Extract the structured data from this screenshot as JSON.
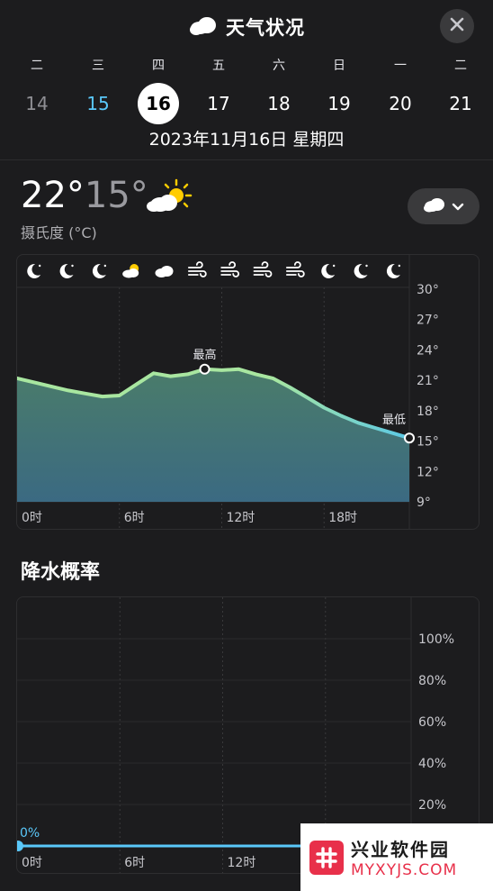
{
  "header": {
    "title": "天气状况",
    "title_icon": "cloud-icon",
    "close_icon": "close-icon"
  },
  "week": {
    "weekdays": [
      "二",
      "三",
      "四",
      "五",
      "六",
      "日",
      "一",
      "二"
    ],
    "dates": [
      "14",
      "15",
      "16",
      "17",
      "18",
      "19",
      "20",
      "21"
    ],
    "today_index": 1,
    "selected_index": 2,
    "full_date": "2023年11月16日 星期四"
  },
  "summary": {
    "high": "22°",
    "low": "15°",
    "unit": "摄氏度 (°C)",
    "condition_icon": "partly-sunny-icon",
    "dropdown_icon": "cloud-icon"
  },
  "chart_data": [
    {
      "type": "area",
      "hourly_icons": [
        "moon-icon",
        "moon-icon",
        "moon-icon",
        "partly-sunny-icon",
        "cloud-icon",
        "wind-icon",
        "wind-icon",
        "wind-icon",
        "wind-icon",
        "moon-icon",
        "moon-icon",
        "moon-icon"
      ],
      "x": [
        0,
        1,
        2,
        3,
        4,
        5,
        6,
        7,
        8,
        9,
        10,
        11,
        12,
        13,
        14,
        15,
        16,
        17,
        18,
        19,
        20,
        21,
        22,
        23
      ],
      "values": [
        21.2,
        20.8,
        20.4,
        20.0,
        19.7,
        19.4,
        19.5,
        20.6,
        21.7,
        21.4,
        21.6,
        22.1,
        22.0,
        22.1,
        21.6,
        21.2,
        20.3,
        19.3,
        18.3,
        17.5,
        16.8,
        16.3,
        15.8,
        15.3
      ],
      "x_ticks": [
        "0时",
        "6时",
        "12时",
        "18时"
      ],
      "y_ticks": [
        "30°",
        "27°",
        "24°",
        "21°",
        "18°",
        "15°",
        "12°",
        "9°"
      ],
      "ylim": [
        9,
        30
      ],
      "annotations": {
        "max_label": "最高",
        "min_label": "最低"
      },
      "colors": {
        "line_warm": "#a8e6a0",
        "line_cool": "#5ac8e6",
        "fill_top": "#4a7c6a",
        "fill_bottom": "#3b6a82"
      }
    },
    {
      "type": "line",
      "title": "降水概率",
      "x": [
        0,
        23
      ],
      "values": [
        0,
        0
      ],
      "start_label": "0%",
      "x_ticks": [
        "0时",
        "6时",
        "12时"
      ],
      "y_ticks": [
        "100%",
        "80%",
        "60%",
        "40%",
        "20%"
      ],
      "ylim": [
        0,
        100
      ],
      "colors": {
        "line": "#5ac8fa"
      }
    }
  ],
  "watermark": {
    "name": "兴业软件园",
    "url": "MYXYJS.COM"
  }
}
